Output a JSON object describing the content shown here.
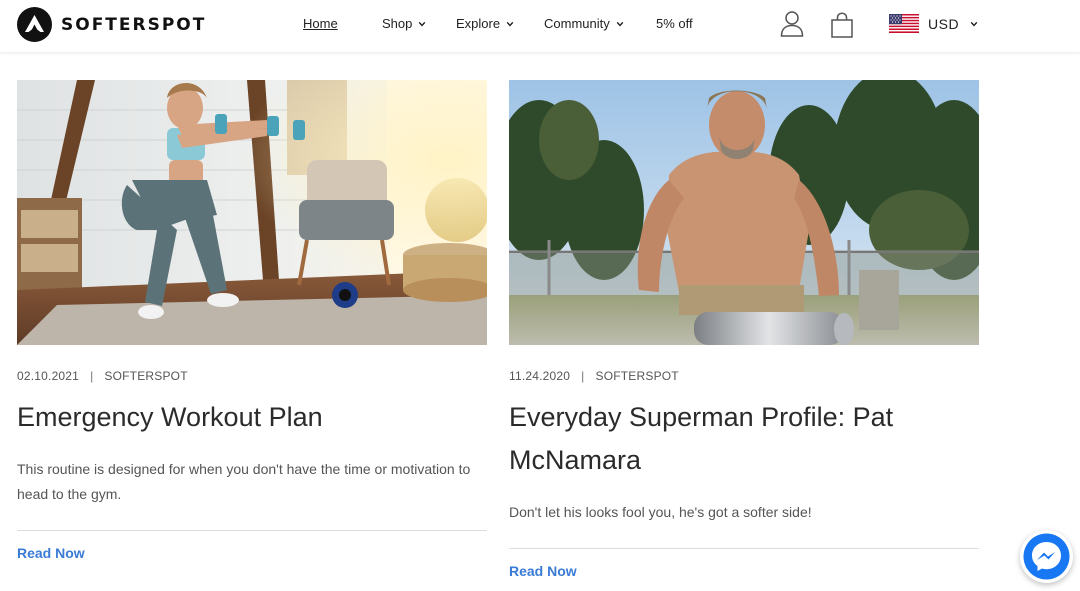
{
  "brand": {
    "name": "SOFTERSPOT",
    "logo_icon": "triangle-logo-icon"
  },
  "nav": {
    "home": "Home",
    "shop": "Shop",
    "explore": "Explore",
    "community": "Community",
    "promo": "5% off"
  },
  "header_icons": {
    "account": "user-icon",
    "cart": "shopping-bag-icon"
  },
  "currency": {
    "flag": "us-flag-icon",
    "label": "USD"
  },
  "posts": [
    {
      "image": "woman-squatting-with-dumbbells-photo",
      "date": "02.10.2021",
      "author": "SOFTERSPOT",
      "title": "Emergency Workout Plan",
      "excerpt": "This routine is designed for when you don't have the time or motivation to head to the gym.",
      "link": "Read Now"
    },
    {
      "image": "shirtless-man-lifting-keg-photo",
      "date": "11.24.2020",
      "author": "SOFTERSPOT",
      "title": "Everyday Superman Profile: Pat McNamara",
      "excerpt": "Don't let his looks fool you, he's got a softer side!",
      "link": "Read Now"
    }
  ],
  "chat_widget": "messenger-icon",
  "colors": {
    "link": "#3a7bd5",
    "messenger": "#1877f2"
  }
}
